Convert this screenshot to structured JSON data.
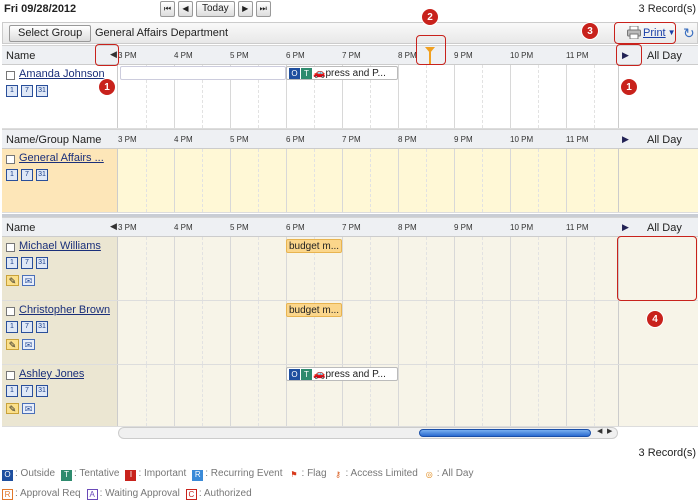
{
  "date_label": "Fri 09/28/2012",
  "nav": {
    "first": "⏮",
    "prev": "◀",
    "today": "Today",
    "next": "▶",
    "last": "⏭"
  },
  "records_label": "3 Record(s)",
  "toolbar": {
    "select_group": "Select Group",
    "department": "General Affairs Department",
    "print": "Print"
  },
  "headers": {
    "name": "Name",
    "name_group": "Name/Group Name",
    "all_day": "All Day"
  },
  "times": [
    "3 PM",
    "4 PM",
    "5 PM",
    "6 PM",
    "7 PM",
    "8 PM",
    "9 PM",
    "10 PM",
    "11 PM"
  ],
  "cal_icon_labels": [
    "1",
    "7",
    "31"
  ],
  "top_user": {
    "name": "Amanda Johnson",
    "event": "press and P..."
  },
  "group": {
    "name": "General Affairs ..."
  },
  "members": [
    {
      "name": "Michael Williams",
      "event": "budget m..."
    },
    {
      "name": "Christopher Brown",
      "event": "budget m..."
    },
    {
      "name": "Ashley Jones",
      "event": "press and P..."
    }
  ],
  "badges": {
    "outside": "O",
    "tentative": "T"
  },
  "callouts": [
    "1",
    "2",
    "3",
    "1",
    "4"
  ],
  "legend_row1": [
    {
      "mark": "O",
      "label": ": Outside",
      "color": "#1f4f9f"
    },
    {
      "mark": "T",
      "label": ": Tentative",
      "color": "#2e8b6e"
    },
    {
      "mark": "I",
      "label": ": Important",
      "color": "#c8221c"
    },
    {
      "mark": "R",
      "label": ": Recurring Event",
      "color": "#3a8ad8"
    },
    {
      "mark": "⚑",
      "label": ": Flag",
      "color": "#d83a1c"
    },
    {
      "mark": "⚷",
      "label": ": Access Limited",
      "color": "#d85a1c"
    },
    {
      "mark": "◎",
      "label": ": All Day",
      "color": "#e08a1c"
    }
  ],
  "legend_row2": [
    {
      "mark": "R",
      "label": ": Approval Req",
      "color": "#e0782c"
    },
    {
      "mark": "A",
      "label": ": Waiting Approval",
      "color": "#6a4ab8"
    },
    {
      "mark": "C",
      "label": ": Authorized",
      "color": "#c8221c"
    }
  ]
}
